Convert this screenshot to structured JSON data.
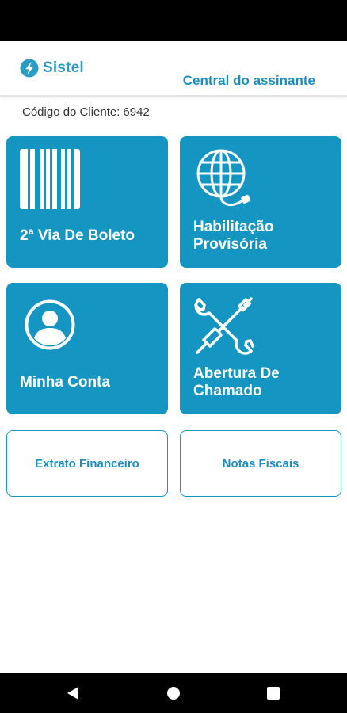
{
  "header": {
    "brand": "Sistel",
    "title": "Central do assinante"
  },
  "client": {
    "label": "Código do Cliente:",
    "code": "6942"
  },
  "tiles": [
    {
      "label": "2ª Via De Boleto",
      "icon": "barcode-icon"
    },
    {
      "label": "Habilitação Provisória",
      "icon": "globe-cable-icon"
    },
    {
      "label": "Minha Conta",
      "icon": "user-avatar-icon"
    },
    {
      "label": "Abertura De Chamado",
      "icon": "tools-icon"
    }
  ],
  "buttons": {
    "statement": "Extrato Financeiro",
    "invoices": "Notas Fiscais"
  },
  "navigation": {
    "icons": [
      "back-icon",
      "home-icon",
      "recents-icon"
    ]
  },
  "colors": {
    "accent": "#1596c2",
    "header_text": "#1a8fbf",
    "brand": "#2b9cc4"
  }
}
